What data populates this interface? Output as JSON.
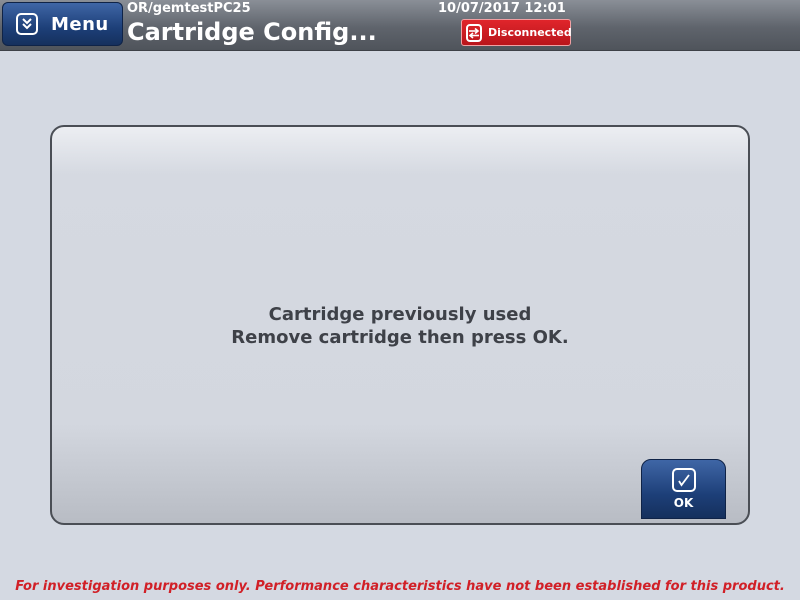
{
  "header": {
    "menu_label": "Menu",
    "menu_icon": "chevron-double-down-icon",
    "path": "OR/gemtestPC25",
    "title": "Cartridge Config...",
    "datetime": "10/07/2017 12:01",
    "status": {
      "label": "Disconnected",
      "icon": "disconnected-icon",
      "color": "#d61e24"
    }
  },
  "dialog": {
    "message_line1": "Cartridge previously used",
    "message_line2": "Remove cartridge then press OK.",
    "ok_label": "OK",
    "ok_icon": "checkmark-icon"
  },
  "footer": {
    "disclaimer": "For investigation purposes only.  Performance characteristics have not been established for this product."
  },
  "colors": {
    "accent_blue": "#1d3f78",
    "background": "#d4d9e2",
    "warning_red": "#d12027"
  }
}
